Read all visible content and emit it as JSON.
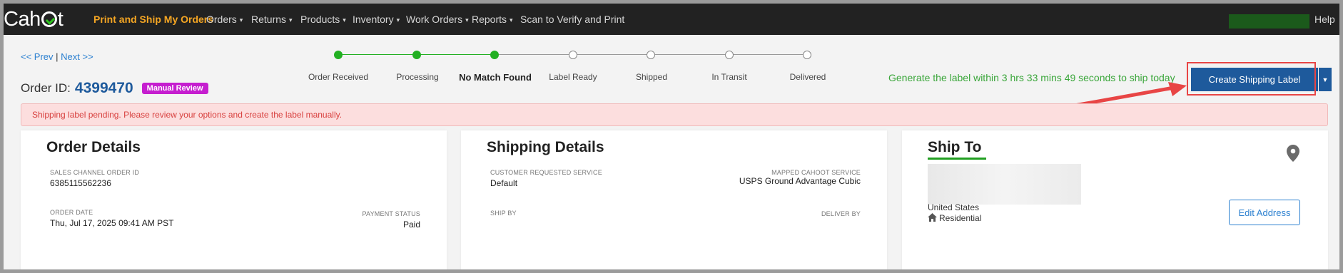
{
  "navbar": {
    "logo_prefix": "Cah",
    "logo_suffix": "t",
    "items": [
      {
        "label": "Print and Ship My Orders"
      },
      {
        "label": "Orders"
      },
      {
        "label": "Returns"
      },
      {
        "label": "Products"
      },
      {
        "label": "Inventory"
      },
      {
        "label": "Work Orders"
      },
      {
        "label": "Reports"
      },
      {
        "label": "Scan to Verify and Print"
      }
    ],
    "help_label": "Help",
    "caret": "▾"
  },
  "pager": {
    "prev": "<< Prev",
    "separator": "|",
    "next": "Next >>"
  },
  "progress": {
    "steps": [
      {
        "label": "Order Received",
        "status": "done"
      },
      {
        "label": "Processing",
        "status": "done"
      },
      {
        "label": "No Match Found",
        "status": "current"
      },
      {
        "label": "Label Ready",
        "status": "todo"
      },
      {
        "label": "Shipped",
        "status": "todo"
      },
      {
        "label": "In Transit",
        "status": "todo"
      },
      {
        "label": "Delivered",
        "status": "todo"
      }
    ],
    "done_color": "#22b022"
  },
  "order": {
    "id_label": "Order ID:",
    "id_value": "4399470",
    "status_badge": "Manual Review"
  },
  "deadline_text": "Generate the label within 3 hrs 33 mins 49 seconds to ship today",
  "create_label": {
    "label": "Create Shipping Label",
    "dropdown_icon": "▼"
  },
  "alert": {
    "message": "Shipping label pending. Please review your options and create the label manually."
  },
  "order_details": {
    "title": "Order Details",
    "sales_channel_order_id_label": "SALES CHANNEL ORDER ID",
    "sales_channel_order_id": "6385115562236",
    "order_date_label": "ORDER DATE",
    "order_date": "Thu, Jul 17, 2025 09:41 AM PST",
    "payment_status_label": "PAYMENT STATUS",
    "payment_status": "Paid"
  },
  "shipping_details": {
    "title": "Shipping Details",
    "customer_requested_service_label": "CUSTOMER REQUESTED SERVICE",
    "customer_requested_service": "Default",
    "mapped_service_label": "MAPPED CAHOOT SERVICE",
    "mapped_service": "USPS Ground Advantage Cubic",
    "ship_by_label": "SHIP BY",
    "deliver_by_label": "DELIVER BY"
  },
  "ship_to": {
    "title": "Ship To",
    "country": "United States",
    "address_type": "Residential",
    "edit_address_label": "Edit Address"
  },
  "colors": {
    "accent_blue": "#1e5a9c",
    "active_nav": "#f5a623",
    "badge": "#c51ecf",
    "annotation_red": "#e84545"
  }
}
